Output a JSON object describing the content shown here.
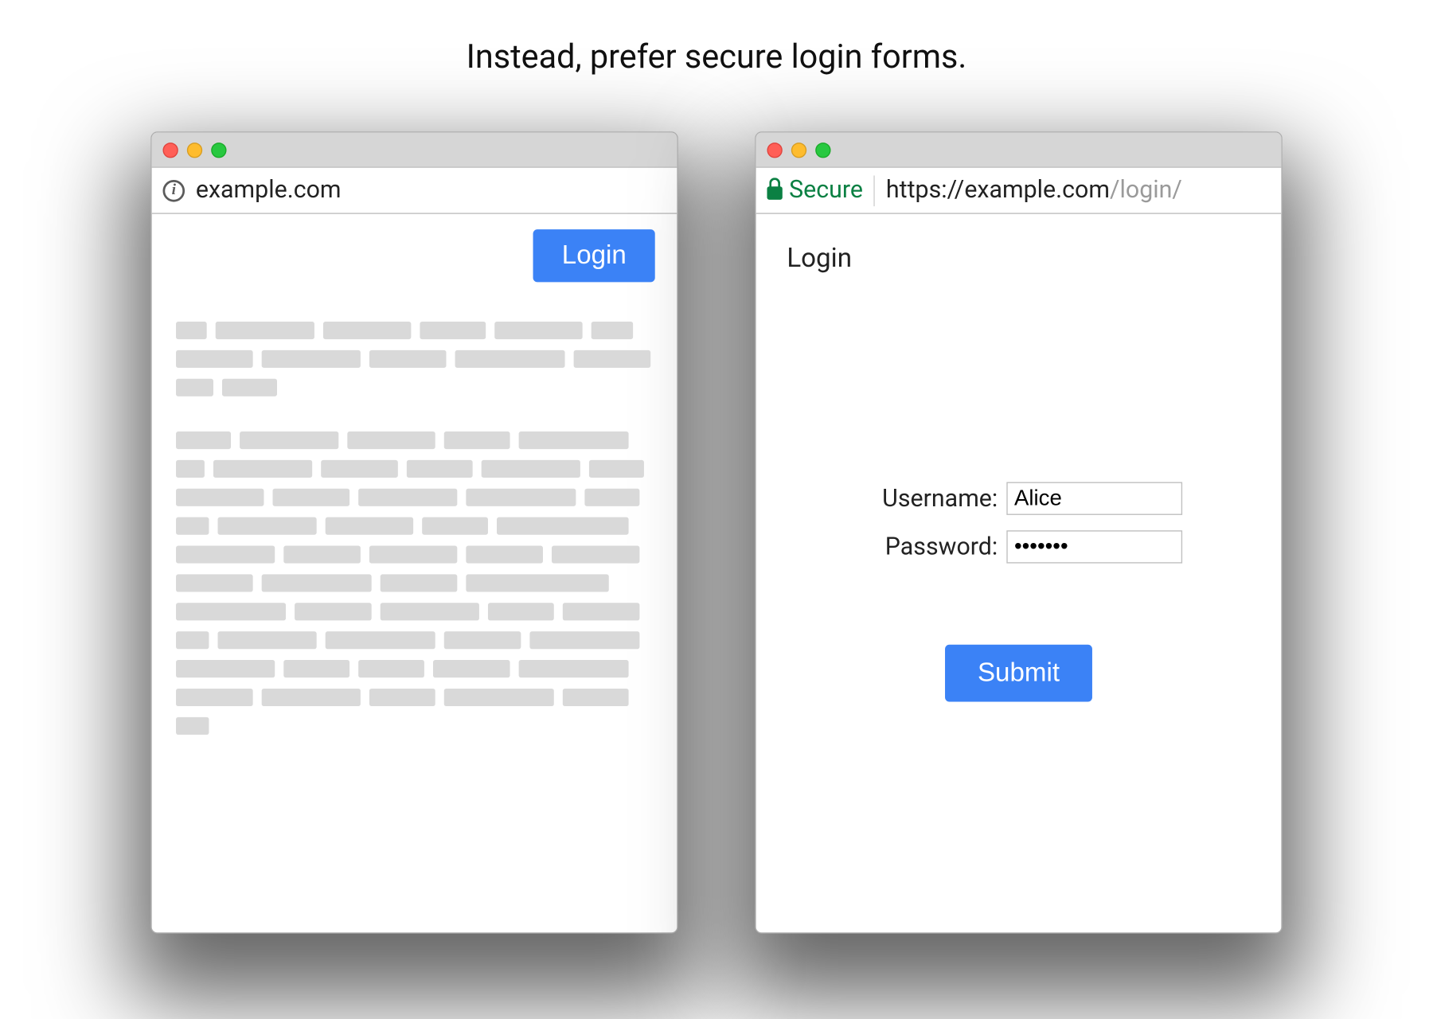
{
  "caption": "Instead, prefer secure login forms.",
  "left_window": {
    "address": "example.com",
    "login_button": "Login"
  },
  "right_window": {
    "secure_label": "Secure",
    "url_scheme": "https://",
    "url_host": "example.com",
    "url_path": "/login/",
    "heading": "Login",
    "username_label": "Username:",
    "password_label": "Password:",
    "username_value": "Alice",
    "password_value": "•••••••",
    "submit_label": "Submit"
  }
}
